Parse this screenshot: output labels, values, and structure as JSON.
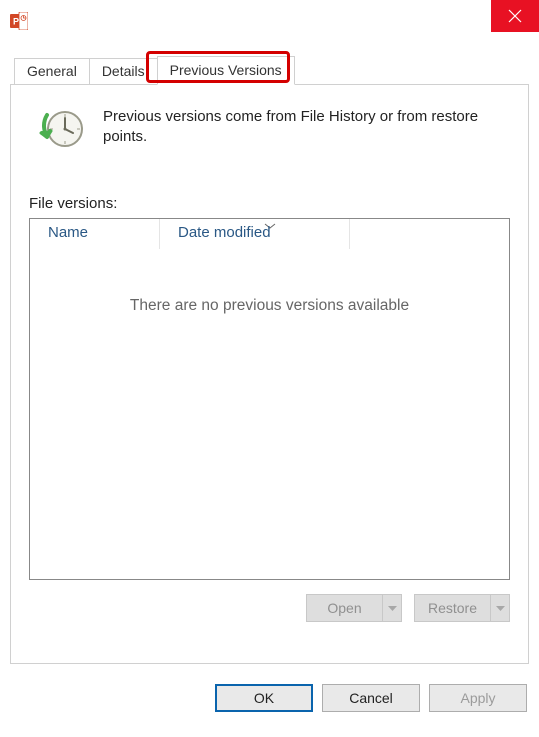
{
  "titlebar": {
    "app_icon": "powerpoint-icon"
  },
  "tabs": {
    "general": "General",
    "details": "Details",
    "previous_versions": "Previous Versions"
  },
  "info": {
    "description": "Previous versions come from File History or from restore points."
  },
  "list": {
    "label": "File versions:",
    "columns": {
      "name": "Name",
      "date_modified": "Date modified"
    },
    "empty_message": "There are no previous versions available"
  },
  "action_buttons": {
    "open": "Open",
    "restore": "Restore"
  },
  "dialog_buttons": {
    "ok": "OK",
    "cancel": "Cancel",
    "apply": "Apply"
  }
}
